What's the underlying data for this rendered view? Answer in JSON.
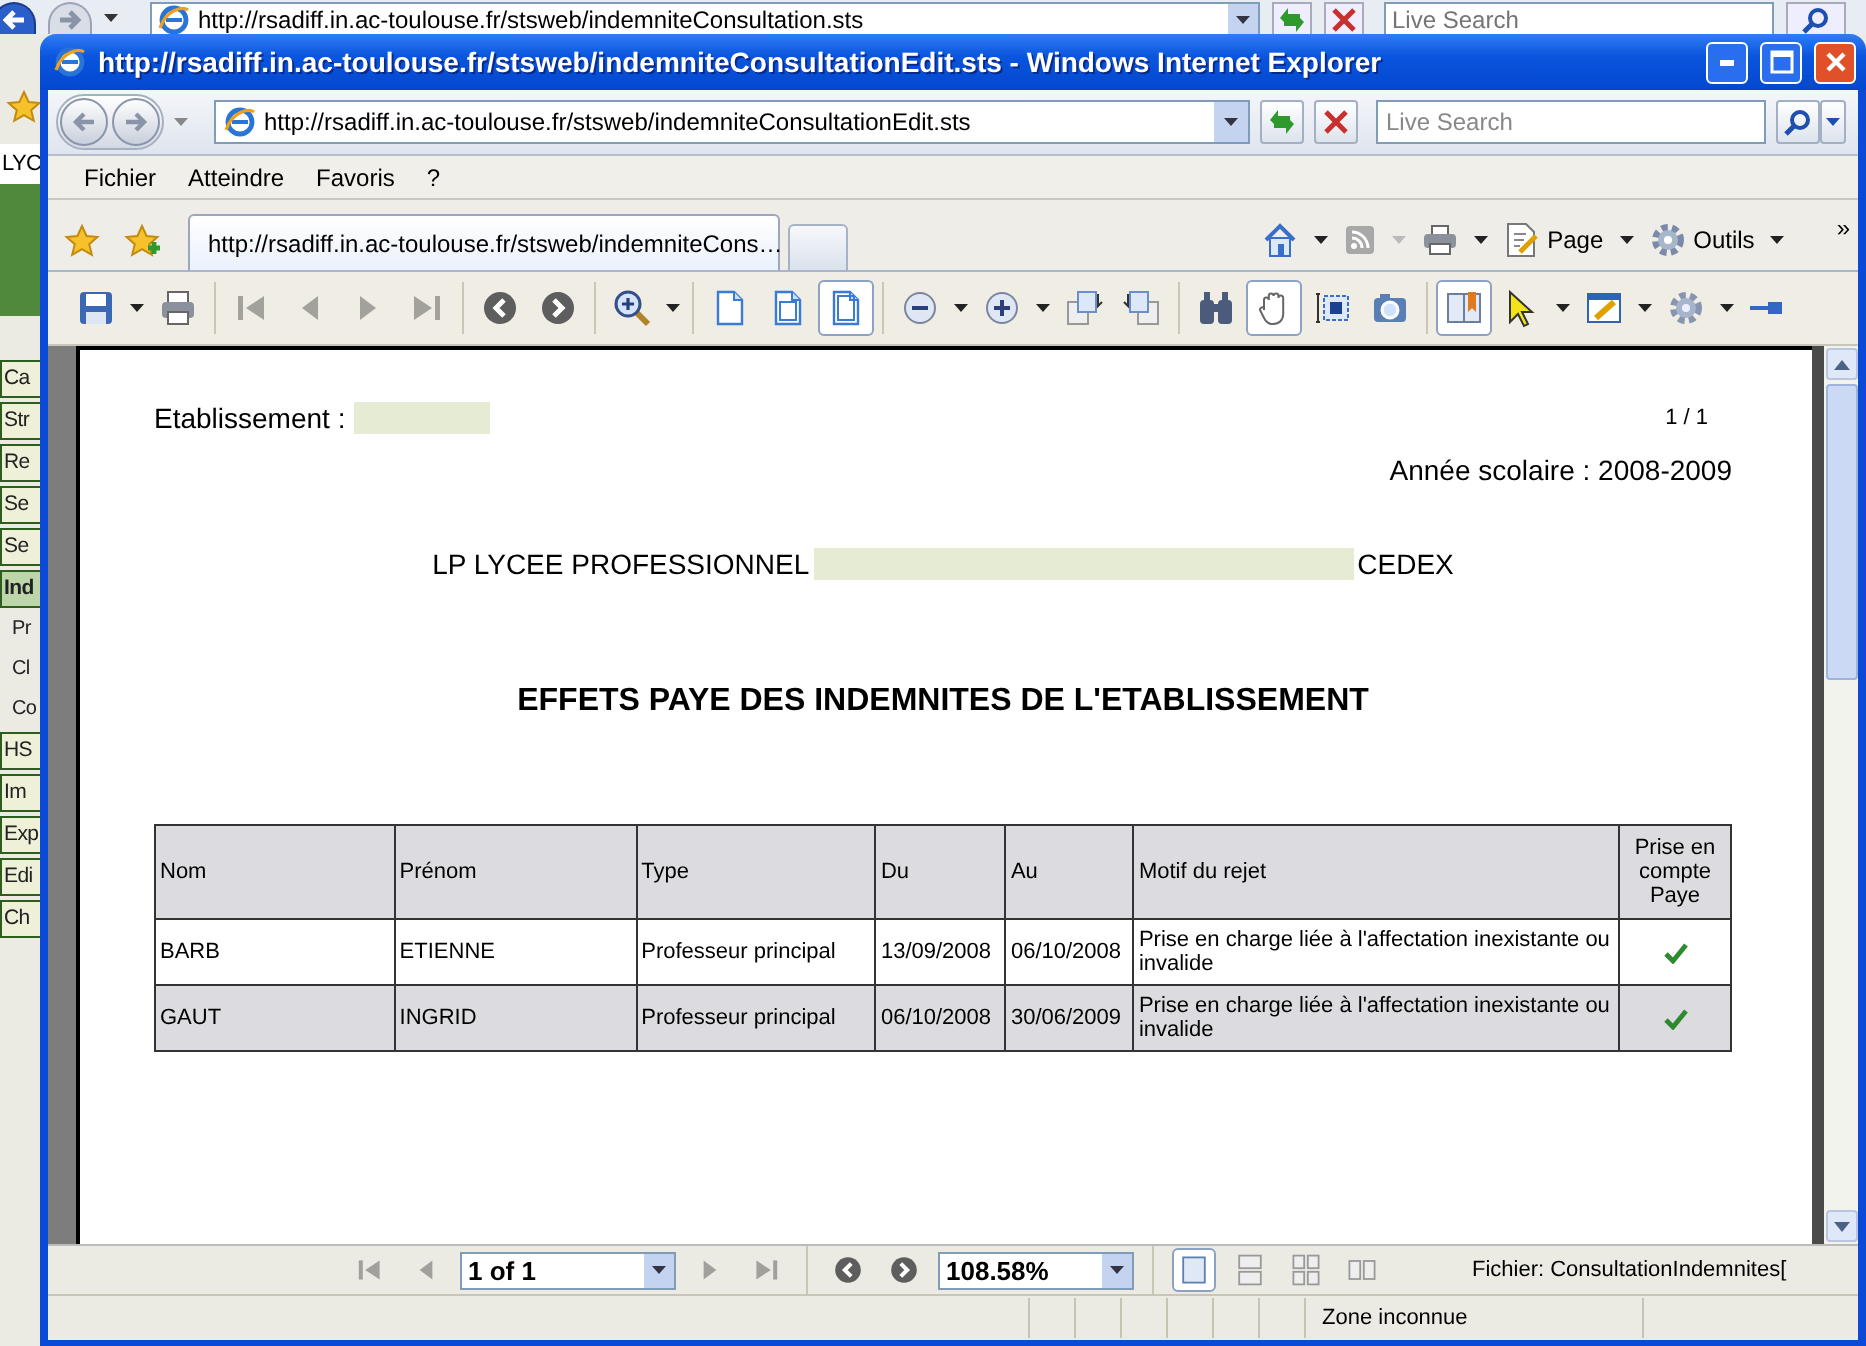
{
  "background_window": {
    "address": "http://rsadiff.in.ac-toulouse.fr/stsweb/indemniteConsultation.sts",
    "search_placeholder": "Live Search",
    "page_heading": "LYC",
    "nav_items": [
      {
        "label": "Ca",
        "kind": "button",
        "selected": false
      },
      {
        "label": "Str",
        "kind": "button",
        "selected": false
      },
      {
        "label": "Re",
        "kind": "button",
        "selected": false
      },
      {
        "label": "Se",
        "kind": "button",
        "selected": false
      },
      {
        "label": "Se",
        "kind": "button",
        "selected": false
      },
      {
        "label": "Ind",
        "kind": "button",
        "selected": true
      },
      {
        "label": "Pr",
        "kind": "sub",
        "selected": false
      },
      {
        "label": "Cl",
        "kind": "sub",
        "selected": false
      },
      {
        "label": "Co",
        "kind": "sub",
        "selected": false
      },
      {
        "label": "HS",
        "kind": "button",
        "selected": false
      },
      {
        "label": "Im",
        "kind": "button",
        "selected": false
      },
      {
        "label": "Exp",
        "kind": "button",
        "selected": false
      },
      {
        "label": "Edi",
        "kind": "button",
        "selected": false
      },
      {
        "label": "Ch",
        "kind": "button",
        "selected": false
      }
    ]
  },
  "window": {
    "title": "http://rsadiff.in.ac-toulouse.fr/stsweb/indemniteConsultationEdit.sts - Windows Internet Explorer",
    "address": "http://rsadiff.in.ac-toulouse.fr/stsweb/indemniteConsultationEdit.sts",
    "search_placeholder": "Live Search",
    "menu": [
      "Fichier",
      "Atteindre",
      "Favoris",
      "?"
    ],
    "tabs": [
      {
        "label": "http://rsadiff.in.ac-toulouse.fr/stsweb/indemniteCons…",
        "selected": true
      }
    ],
    "command_bar": [
      {
        "kind": "home",
        "menu": true,
        "disabled": false
      },
      {
        "kind": "feeds",
        "menu": true,
        "disabled": true
      },
      {
        "kind": "print",
        "menu": true,
        "disabled": false
      },
      {
        "kind": "page",
        "label": "Page",
        "menu": true,
        "disabled": false
      },
      {
        "kind": "tools",
        "label": "Outils",
        "menu": true,
        "disabled": false
      }
    ],
    "more": "»"
  },
  "reader_toolbar": [
    {
      "kind": "save",
      "menu": true,
      "selected": false,
      "disabled": false
    },
    {
      "kind": "print",
      "menu": false,
      "selected": false,
      "disabled": false
    },
    {
      "kind": "separator"
    },
    {
      "kind": "first-page",
      "menu": false,
      "selected": false,
      "disabled": true
    },
    {
      "kind": "previous-page",
      "menu": false,
      "selected": false,
      "disabled": true
    },
    {
      "kind": "next-page",
      "menu": false,
      "selected": false,
      "disabled": true
    },
    {
      "kind": "last-page",
      "menu": false,
      "selected": false,
      "disabled": true
    },
    {
      "kind": "separator"
    },
    {
      "kind": "previous-view",
      "menu": false,
      "selected": false,
      "disabled": false
    },
    {
      "kind": "next-view",
      "menu": false,
      "selected": false,
      "disabled": false
    },
    {
      "kind": "separator"
    },
    {
      "kind": "zoom",
      "menu": true,
      "selected": false,
      "disabled": false
    },
    {
      "kind": "separator"
    },
    {
      "kind": "actual-size",
      "menu": false,
      "selected": false,
      "disabled": false
    },
    {
      "kind": "fit-width",
      "menu": false,
      "selected": false,
      "disabled": false
    },
    {
      "kind": "fit-page",
      "menu": false,
      "selected": true,
      "disabled": false
    },
    {
      "kind": "separator"
    },
    {
      "kind": "zoom-out",
      "menu": true,
      "selected": false,
      "disabled": false
    },
    {
      "kind": "zoom-in",
      "menu": true,
      "selected": false,
      "disabled": false
    },
    {
      "kind": "rotate-clockwise",
      "menu": false,
      "selected": false,
      "disabled": false
    },
    {
      "kind": "rotate-counterclockwise",
      "menu": false,
      "selected": false,
      "disabled": false
    },
    {
      "kind": "separator"
    },
    {
      "kind": "find",
      "menu": false,
      "selected": false,
      "disabled": false
    },
    {
      "kind": "hand",
      "menu": false,
      "selected": true,
      "disabled": false
    },
    {
      "kind": "select-text",
      "menu": false,
      "selected": false,
      "disabled": false
    },
    {
      "kind": "snapshot",
      "menu": false,
      "selected": false,
      "disabled": false
    },
    {
      "kind": "separator"
    },
    {
      "kind": "bookmarks",
      "menu": false,
      "selected": true,
      "disabled": false
    },
    {
      "kind": "select",
      "menu": true,
      "selected": false,
      "disabled": false
    },
    {
      "kind": "comment",
      "menu": true,
      "selected": false,
      "disabled": false
    },
    {
      "kind": "tools",
      "menu": true,
      "selected": false,
      "disabled": false
    },
    {
      "kind": "pin",
      "menu": false,
      "selected": false,
      "disabled": false
    }
  ],
  "document": {
    "establishment_label": "Etablissement :",
    "page_number": "1 / 1",
    "school_year": "Année scolaire : 2008-2009",
    "school_prefix": "LP LYCEE PROFESSIONNEL",
    "school_suffix": "CEDEX",
    "title": "EFFETS PAYE DES INDEMNITES DE L'ETABLISSEMENT",
    "table": {
      "columns": [
        "Nom",
        "Prénom",
        "Type",
        "Du",
        "Au",
        "Motif du rejet",
        "Prise en compte Paye"
      ],
      "rows": [
        {
          "cells": [
            "BARB",
            "ETIENNE",
            "Professeur principal",
            "13/09/2008",
            "06/10/2008",
            "Prise en charge liée à l'affectation inexistante ou invalide"
          ],
          "counted": true
        },
        {
          "cells": [
            "GAUT",
            "INGRID",
            "Professeur principal",
            "06/10/2008",
            "30/06/2009",
            "Prise en charge liée à l'affectation inexistante ou invalide"
          ],
          "counted": true
        }
      ]
    }
  },
  "reader_navbar": {
    "items": [
      {
        "kind": "first-page",
        "disabled": true
      },
      {
        "kind": "previous-page",
        "disabled": true
      },
      {
        "kind": "page-field",
        "value": "1 of 1"
      },
      {
        "kind": "next-page",
        "disabled": true
      },
      {
        "kind": "last-page",
        "disabled": true
      },
      {
        "kind": "separator"
      },
      {
        "kind": "previous-view",
        "disabled": false
      },
      {
        "kind": "next-view",
        "disabled": false
      },
      {
        "kind": "zoom-field",
        "value": "108.58%"
      },
      {
        "kind": "separator"
      }
    ],
    "layouts": [
      {
        "kind": "single",
        "selected": true
      },
      {
        "kind": "continuous",
        "selected": false
      },
      {
        "kind": "continuous-facing",
        "selected": false
      },
      {
        "kind": "facing",
        "selected": false
      }
    ],
    "file": "Fichier: ConsultationIndemnites["
  },
  "status_bar": {
    "zone": "Zone inconnue"
  }
}
